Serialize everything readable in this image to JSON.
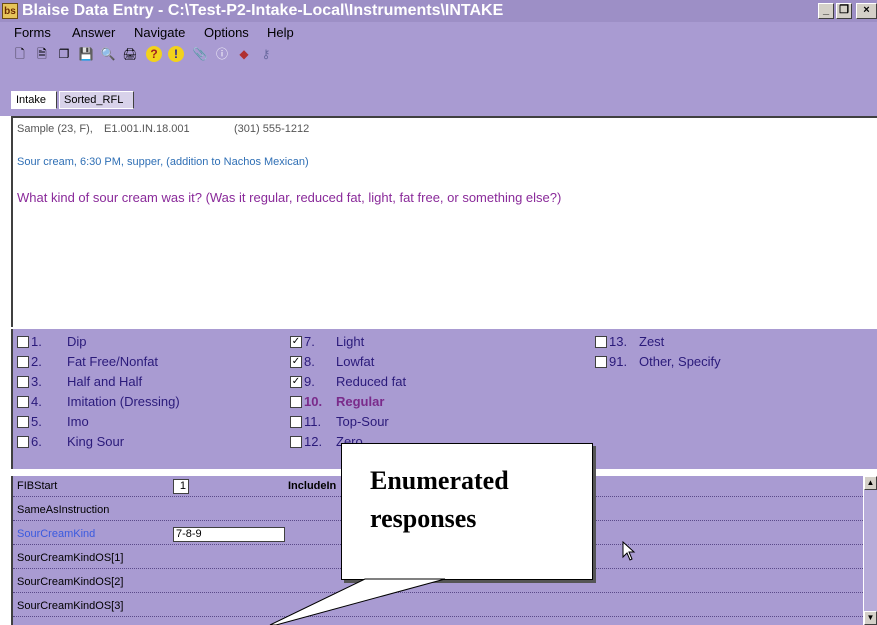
{
  "window": {
    "title": "Blaise Data Entry - C:\\Test-P2-Intake-Local\\Instruments\\INTAKE",
    "icon_text": "bs",
    "minimize": "_",
    "restore": "❐",
    "close": "×"
  },
  "menu": [
    "Forms",
    "Answer",
    "Navigate",
    "Options",
    "Help"
  ],
  "toolbar": [
    {
      "icon": "new-page-icon",
      "glyph": "🗋"
    },
    {
      "icon": "document-icon",
      "glyph": "🗎"
    },
    {
      "icon": "copy-icon",
      "glyph": "❐"
    },
    {
      "icon": "save-icon",
      "glyph": "💾"
    },
    {
      "icon": "find-icon",
      "glyph": "🔍"
    },
    {
      "icon": "print-preview-icon",
      "glyph": "🖨"
    },
    {
      "icon": "help-icon",
      "glyph": "?"
    },
    {
      "icon": "alert-icon",
      "glyph": "!"
    },
    {
      "icon": "paperclip-icon",
      "glyph": "📎"
    },
    {
      "icon": "info-icon",
      "glyph": "ⓘ"
    },
    {
      "icon": "tag-icon",
      "glyph": "◆"
    },
    {
      "icon": "key-icon",
      "glyph": "⚷"
    }
  ],
  "tabs": [
    {
      "label": "Intake",
      "active": true
    },
    {
      "label": "Sorted_RFL",
      "active": false
    }
  ],
  "question": {
    "respondent": "Sample (23, F),",
    "case_id": "E1.001.IN.18.001",
    "phone": "(301) 555-1212",
    "context": "Sour cream, 6:30 PM, supper, (addition to Nachos Mexican)",
    "text": "What kind of sour cream was it? (Was it regular, reduced fat, light, fat free, or something else?)"
  },
  "options": [
    {
      "num": "1.",
      "label": "Dip",
      "checked": false
    },
    {
      "num": "2.",
      "label": "Fat Free/Nonfat",
      "checked": false
    },
    {
      "num": "3.",
      "label": "Half and Half",
      "checked": false
    },
    {
      "num": "4.",
      "label": "Imitation (Dressing)",
      "checked": false
    },
    {
      "num": "5.",
      "label": "Imo",
      "checked": false
    },
    {
      "num": "6.",
      "label": "King Sour",
      "checked": false
    },
    {
      "num": "7.",
      "label": "Light",
      "checked": true
    },
    {
      "num": "8.",
      "label": "Lowfat",
      "checked": true
    },
    {
      "num": "9.",
      "label": "Reduced fat",
      "checked": true
    },
    {
      "num": "10.",
      "label": "Regular",
      "checked": false,
      "bold": true
    },
    {
      "num": "11.",
      "label": "Top-Sour",
      "checked": false
    },
    {
      "num": "12.",
      "label": "Zero",
      "checked": false
    },
    {
      "num": "13.",
      "label": "Zest",
      "checked": false
    },
    {
      "num": "91.",
      "label": "Other, Specify",
      "checked": false
    }
  ],
  "fields": [
    {
      "name": "FIBStart",
      "value": "1",
      "extra_label": "IncludeIn"
    },
    {
      "name": "SameAsInstruction",
      "value": ""
    },
    {
      "name": "SourCreamKind",
      "value": "7-8-9",
      "active": true
    },
    {
      "name": "SourCreamKindOS[1]",
      "value": ""
    },
    {
      "name": "SourCreamKindOS[2]",
      "value": ""
    },
    {
      "name": "SourCreamKindOS[3]",
      "value": ""
    }
  ],
  "callout": {
    "line1": "Enumerated",
    "line2": "responses"
  },
  "colors": {
    "titlebar": "#9d8fc6",
    "panel": "#a99bd2",
    "question_context": "#2f6fb5",
    "question_text": "#8a2a9a",
    "option_text": "#2a1a7a"
  }
}
